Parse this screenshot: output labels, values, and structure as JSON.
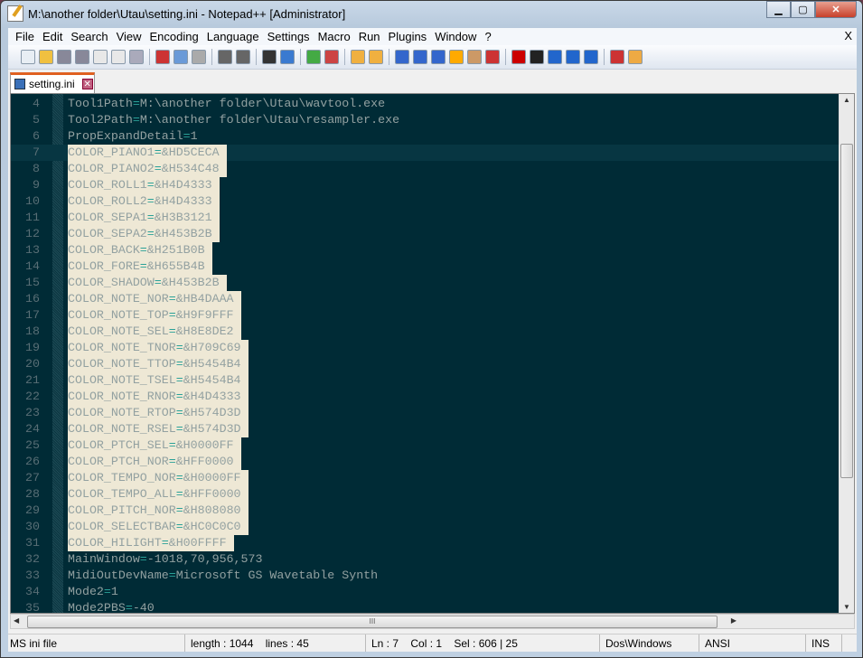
{
  "window": {
    "title": "M:\\another folder\\Utau\\setting.ini - Notepad++ [Administrator]",
    "minimize": "▁",
    "maximize": "▢",
    "close": "✕"
  },
  "menu": [
    "File",
    "Edit",
    "Search",
    "View",
    "Encoding",
    "Language",
    "Settings",
    "Macro",
    "Run",
    "Plugins",
    "Window",
    "?"
  ],
  "menu_close": "X",
  "toolbar": [
    "new-file",
    "open",
    "save",
    "save-all",
    "close",
    "close-all",
    "print",
    "cut",
    "copy",
    "paste",
    "undo",
    "redo",
    "find",
    "replace",
    "zoom-in",
    "zoom-out",
    "sync-vertical",
    "sync-horizontal",
    "word-wrap",
    "show-all-chars",
    "indent-guide",
    "user-lang",
    "doc-map",
    "function-list",
    "record-macro",
    "stop-record",
    "play-macro",
    "run-macro-multiple",
    "save-macro",
    "spell-check",
    "abc-options"
  ],
  "colors": {
    "editor_bg": "#002b36",
    "text": "#93a1a1",
    "operator": "#2aa198",
    "selection": "#eee8d5",
    "current_line": "#073642",
    "line_numbers": "#586e75"
  },
  "tab": {
    "label": "setting.ini",
    "close": "✕"
  },
  "editor": {
    "current_line": 7,
    "selection_lines": [
      7,
      31
    ],
    "lines": [
      {
        "n": 4,
        "k": "Tool1Path",
        "v": "M:\\another folder\\Utau\\wavtool.exe"
      },
      {
        "n": 5,
        "k": "Tool2Path",
        "v": "M:\\another folder\\Utau\\resampler.exe"
      },
      {
        "n": 6,
        "k": "PropExpandDetail",
        "v": "1"
      },
      {
        "n": 7,
        "k": "COLOR_PIANO1",
        "v": "&HD5CECA"
      },
      {
        "n": 8,
        "k": "COLOR_PIANO2",
        "v": "&H534C48"
      },
      {
        "n": 9,
        "k": "COLOR_ROLL1",
        "v": "&H4D4333"
      },
      {
        "n": 10,
        "k": "COLOR_ROLL2",
        "v": "&H4D4333"
      },
      {
        "n": 11,
        "k": "COLOR_SEPA1",
        "v": "&H3B3121"
      },
      {
        "n": 12,
        "k": "COLOR_SEPA2",
        "v": "&H453B2B"
      },
      {
        "n": 13,
        "k": "COLOR_BACK",
        "v": "&H251B0B"
      },
      {
        "n": 14,
        "k": "COLOR_FORE",
        "v": "&H655B4B"
      },
      {
        "n": 15,
        "k": "COLOR_SHADOW",
        "v": "&H453B2B"
      },
      {
        "n": 16,
        "k": "COLOR_NOTE_NOR",
        "v": "&HB4DAAA"
      },
      {
        "n": 17,
        "k": "COLOR_NOTE_TOP",
        "v": "&H9F9FFF"
      },
      {
        "n": 18,
        "k": "COLOR_NOTE_SEL",
        "v": "&H8E8DE2"
      },
      {
        "n": 19,
        "k": "COLOR_NOTE_TNOR",
        "v": "&H709C69"
      },
      {
        "n": 20,
        "k": "COLOR_NOTE_TTOP",
        "v": "&H5454B4"
      },
      {
        "n": 21,
        "k": "COLOR_NOTE_TSEL",
        "v": "&H5454B4"
      },
      {
        "n": 22,
        "k": "COLOR_NOTE_RNOR",
        "v": "&H4D4333"
      },
      {
        "n": 23,
        "k": "COLOR_NOTE_RTOP",
        "v": "&H574D3D"
      },
      {
        "n": 24,
        "k": "COLOR_NOTE_RSEL",
        "v": "&H574D3D"
      },
      {
        "n": 25,
        "k": "COLOR_PTCH_SEL",
        "v": "&H0000FF"
      },
      {
        "n": 26,
        "k": "COLOR_PTCH_NOR",
        "v": "&HFF0000"
      },
      {
        "n": 27,
        "k": "COLOR_TEMPO_NOR",
        "v": "&H0000FF"
      },
      {
        "n": 28,
        "k": "COLOR_TEMPO_ALL",
        "v": "&HFF0000"
      },
      {
        "n": 29,
        "k": "COLOR_PITCH_NOR",
        "v": "&H808080"
      },
      {
        "n": 30,
        "k": "COLOR_SELECTBAR",
        "v": "&HC0C0C0"
      },
      {
        "n": 31,
        "k": "COLOR_HILIGHT",
        "v": "&H00FFFF"
      },
      {
        "n": 32,
        "k": "MainWindow",
        "v": "-1018,70,956,573"
      },
      {
        "n": 33,
        "k": "MidiOutDevName",
        "v": "Microsoft GS Wavetable Synth"
      },
      {
        "n": 34,
        "k": "Mode2",
        "v": "1"
      },
      {
        "n": 35,
        "k": "Mode2PBS",
        "v": "-40"
      }
    ]
  },
  "hscroll_grip": "III",
  "status": {
    "type": "MS ini file",
    "length": "length : 1044    lines : 45",
    "pos": "Ln : 7    Col : 1    Sel : 606 | 25",
    "eol": "Dos\\Windows",
    "encoding": "ANSI",
    "mode": "INS"
  }
}
